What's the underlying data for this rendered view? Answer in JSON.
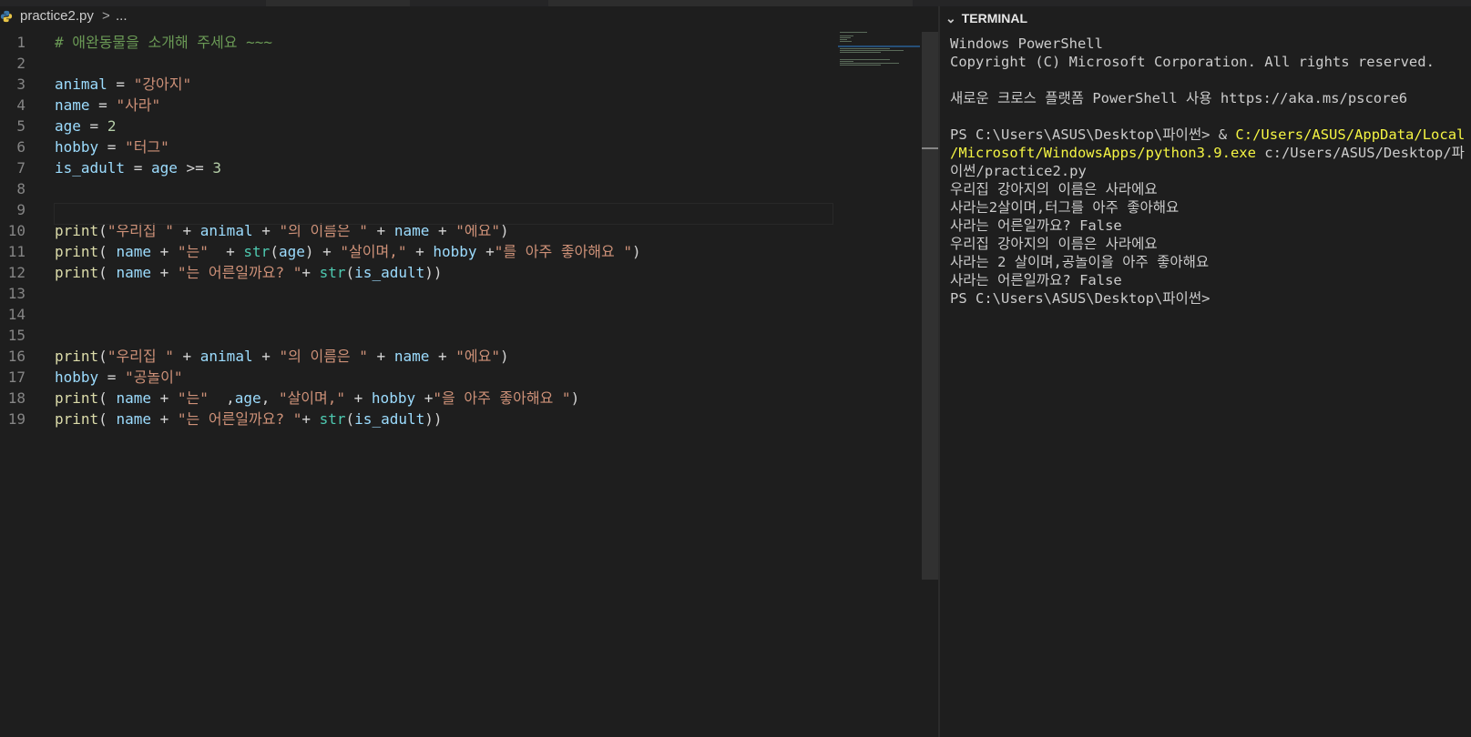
{
  "breadcrumb": {
    "file": "practice2.py",
    "separator": ">",
    "more": "..."
  },
  "editor": {
    "line_numbers": [
      "1",
      "2",
      "3",
      "4",
      "5",
      "6",
      "7",
      "8",
      "9",
      "10",
      "11",
      "12",
      "13",
      "14",
      "15",
      "16",
      "17",
      "18",
      "19"
    ],
    "lines": [
      [
        [
          "com",
          "# 애완동물을 소개해 주세요 ~~~"
        ]
      ],
      [],
      [
        [
          "var",
          "animal"
        ],
        [
          "op",
          " = "
        ],
        [
          "str",
          "\"강아지\""
        ]
      ],
      [
        [
          "var",
          "name"
        ],
        [
          "op",
          " = "
        ],
        [
          "str",
          "\"사라\""
        ]
      ],
      [
        [
          "var",
          "age"
        ],
        [
          "op",
          " = "
        ],
        [
          "num",
          "2"
        ]
      ],
      [
        [
          "var",
          "hobby"
        ],
        [
          "op",
          " = "
        ],
        [
          "str",
          "\"터그\""
        ]
      ],
      [
        [
          "var",
          "is_adult"
        ],
        [
          "op",
          " = "
        ],
        [
          "var",
          "age"
        ],
        [
          "op",
          " >= "
        ],
        [
          "num",
          "3"
        ]
      ],
      [],
      [],
      [
        [
          "fn",
          "print"
        ],
        [
          "op",
          "("
        ],
        [
          "str",
          "\"우리집 \""
        ],
        [
          "op",
          " + "
        ],
        [
          "var",
          "animal"
        ],
        [
          "op",
          " + "
        ],
        [
          "str",
          "\"의 이름은 \""
        ],
        [
          "op",
          " + "
        ],
        [
          "var",
          "name"
        ],
        [
          "op",
          " + "
        ],
        [
          "str",
          "\"에요\""
        ],
        [
          "op",
          ")"
        ]
      ],
      [
        [
          "fn",
          "print"
        ],
        [
          "op",
          "( "
        ],
        [
          "var",
          "name"
        ],
        [
          "op",
          " + "
        ],
        [
          "str",
          "\"는\""
        ],
        [
          "op",
          "  + "
        ],
        [
          "bi",
          "str"
        ],
        [
          "op",
          "("
        ],
        [
          "var",
          "age"
        ],
        [
          "op",
          ") + "
        ],
        [
          "str",
          "\"살이며,\""
        ],
        [
          "op",
          " + "
        ],
        [
          "var",
          "hobby"
        ],
        [
          "op",
          " +"
        ],
        [
          "str",
          "\"를 아주 좋아해요 \""
        ],
        [
          "op",
          ")"
        ]
      ],
      [
        [
          "fn",
          "print"
        ],
        [
          "op",
          "( "
        ],
        [
          "var",
          "name"
        ],
        [
          "op",
          " + "
        ],
        [
          "str",
          "\"는 어른일까요? \""
        ],
        [
          "op",
          "+ "
        ],
        [
          "bi",
          "str"
        ],
        [
          "op",
          "("
        ],
        [
          "var",
          "is_adult"
        ],
        [
          "op",
          "))"
        ]
      ],
      [],
      [],
      [],
      [
        [
          "fn",
          "print"
        ],
        [
          "op",
          "("
        ],
        [
          "str",
          "\"우리집 \""
        ],
        [
          "op",
          " + "
        ],
        [
          "var",
          "animal"
        ],
        [
          "op",
          " + "
        ],
        [
          "str",
          "\"의 이름은 \""
        ],
        [
          "op",
          " + "
        ],
        [
          "var",
          "name"
        ],
        [
          "op",
          " + "
        ],
        [
          "str",
          "\"에요\""
        ],
        [
          "op",
          ")"
        ]
      ],
      [
        [
          "var",
          "hobby"
        ],
        [
          "op",
          " = "
        ],
        [
          "str",
          "\"공놀이\""
        ]
      ],
      [
        [
          "fn",
          "print"
        ],
        [
          "op",
          "( "
        ],
        [
          "var",
          "name"
        ],
        [
          "op",
          " + "
        ],
        [
          "str",
          "\"는\""
        ],
        [
          "op",
          "  ,"
        ],
        [
          "var",
          "age"
        ],
        [
          "op",
          ", "
        ],
        [
          "str",
          "\"살이며,\""
        ],
        [
          "op",
          " + "
        ],
        [
          "var",
          "hobby"
        ],
        [
          "op",
          " +"
        ],
        [
          "str",
          "\"을 아주 좋아해요 \""
        ],
        [
          "op",
          ")"
        ]
      ],
      [
        [
          "fn",
          "print"
        ],
        [
          "op",
          "( "
        ],
        [
          "var",
          "name"
        ],
        [
          "op",
          " + "
        ],
        [
          "str",
          "\"는 어른일까요? \""
        ],
        [
          "op",
          "+ "
        ],
        [
          "bi",
          "str"
        ],
        [
          "op",
          "("
        ],
        [
          "var",
          "is_adult"
        ],
        [
          "op",
          "))"
        ]
      ]
    ]
  },
  "terminal": {
    "title": "TERMINAL",
    "lines": [
      [
        [
          "n",
          "Windows PowerShell"
        ]
      ],
      [
        [
          "n",
          "Copyright (C) Microsoft Corporation. All rights reserved."
        ]
      ],
      [],
      [
        [
          "n",
          "새로운 크로스 플랫폼 PowerShell 사용 https://aka.ms/pscore6"
        ]
      ],
      [],
      [
        [
          "n",
          "PS C:\\Users\\ASUS\\Desktop\\파이썬> & "
        ],
        [
          "y",
          "C:/Users/ASUS/AppData/Local"
        ]
      ],
      [
        [
          "y",
          "/Microsoft/WindowsApps/python3.9.exe"
        ],
        [
          "n",
          " c:/Users/ASUS/Desktop/파"
        ]
      ],
      [
        [
          "n",
          "이썬/practice2.py"
        ]
      ],
      [
        [
          "n",
          "우리집 강아지의 이름은 사라에요"
        ]
      ],
      [
        [
          "n",
          "사라는2살이며,터그를 아주 좋아해요"
        ]
      ],
      [
        [
          "n",
          "사라는 어른일까요? False"
        ]
      ],
      [
        [
          "n",
          "우리집 강아지의 이름은 사라에요"
        ]
      ],
      [
        [
          "n",
          "사라는 2 살이며,공놀이을 아주 좋아해요"
        ]
      ],
      [
        [
          "n",
          "사라는 어른일까요? False"
        ]
      ],
      [
        [
          "n",
          "PS C:\\Users\\ASUS\\Desktop\\파이썬>"
        ]
      ]
    ]
  }
}
